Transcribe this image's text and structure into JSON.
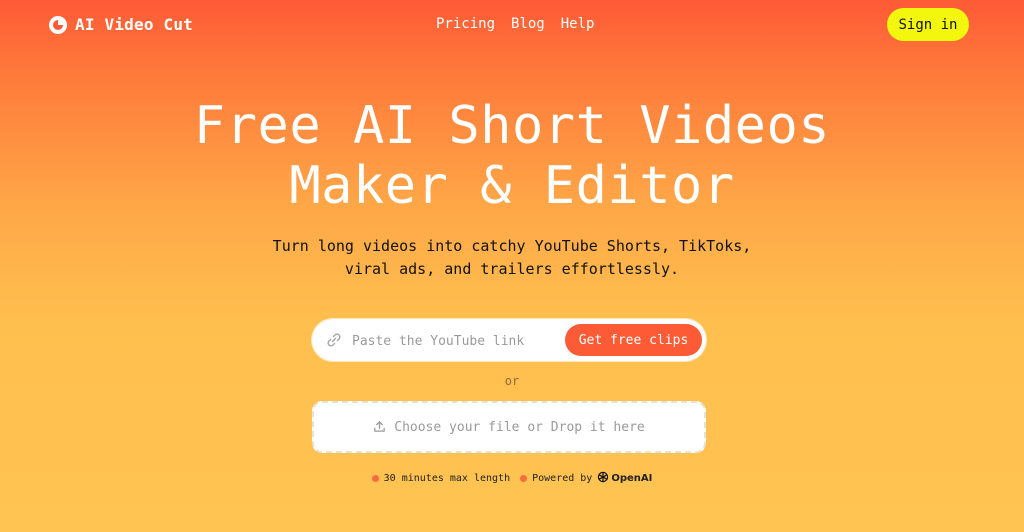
{
  "header": {
    "brand_name": "AI Video Cut",
    "nav": [
      {
        "label": "Pricing"
      },
      {
        "label": "Blog"
      },
      {
        "label": "Help"
      }
    ],
    "sign_in_label": "Sign in"
  },
  "hero": {
    "title_line1": "Free AI Short Videos",
    "title_line2": "Maker & Editor",
    "subtitle_line1": "Turn long videos into catchy YouTube Shorts, TikToks,",
    "subtitle_line2": "viral ads, and trailers effortlessly."
  },
  "link_form": {
    "placeholder": "Paste the YouTube link",
    "value": "",
    "button_label": "Get free clips",
    "icon": "link-icon"
  },
  "separator_text": "or",
  "upload": {
    "label": "Choose your file or Drop it here",
    "icon": "upload-icon"
  },
  "notes": {
    "max_length": "30 minutes max length",
    "powered_by": "Powered by",
    "provider": "OpenAI"
  },
  "colors": {
    "accent": "#fd5a36",
    "sign_in_bg": "#f3f70e",
    "gradient_top": "#fd5a36",
    "gradient_bottom": "#ffc452"
  }
}
